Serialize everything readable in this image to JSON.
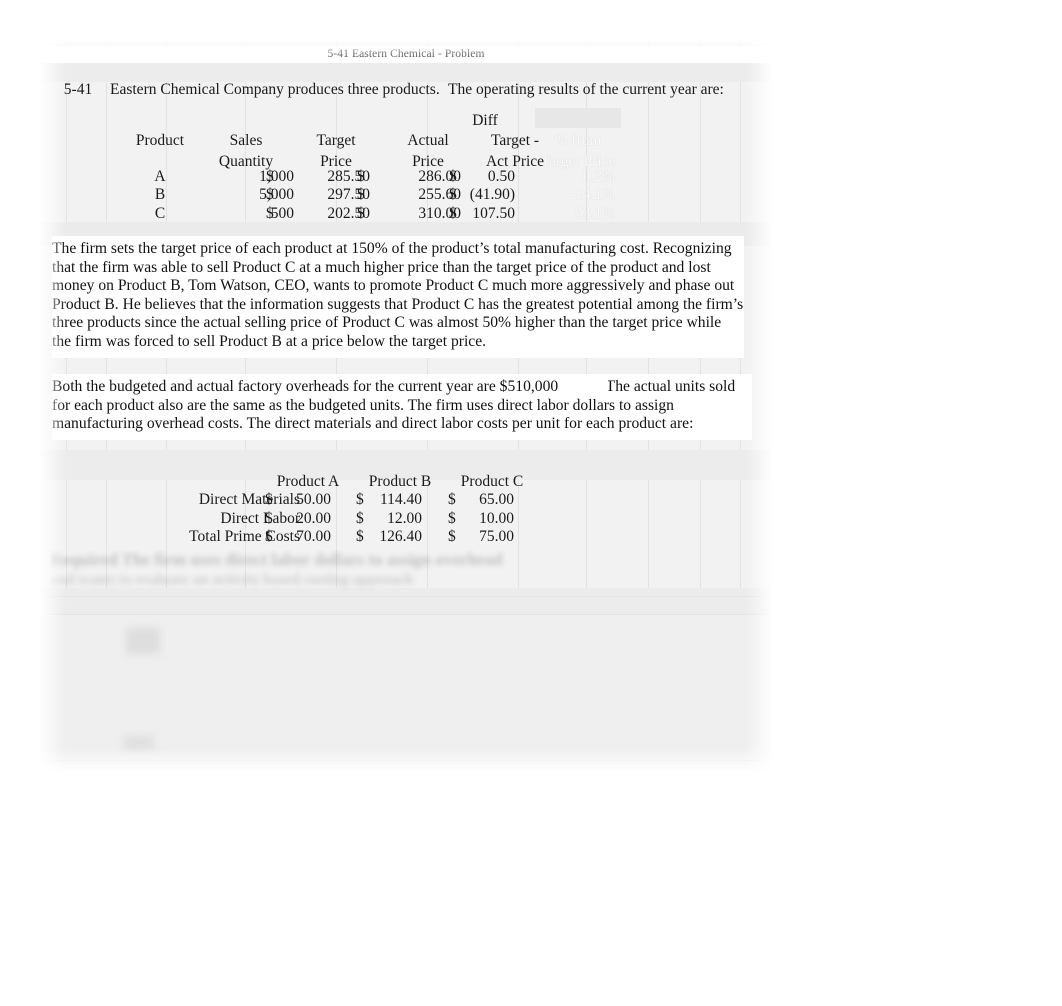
{
  "document": {
    "page_header": "5-41 Eastern Chemical - Problem",
    "problem_number": "5-41",
    "intro_left": "Eastern Chemical Company produces three products.",
    "intro_right": "The operating results of the current year are:"
  },
  "operating_results_table": {
    "headers": {
      "diff_label": "Diff",
      "row1": [
        "Product",
        "Sales",
        "Target",
        "Actual",
        "Target -",
        "% from"
      ],
      "row2": [
        "",
        "Quantity",
        "Price",
        "Price",
        "Act Price",
        "Target Price"
      ]
    },
    "rows": [
      {
        "product": "A",
        "sales_quantity": "1,000",
        "target_price_sym": "$",
        "target_price": "285.50",
        "actual_price_sym": "$",
        "actual_price": "286.00",
        "diff_sym": "$",
        "diff": "0.50",
        "pct_from_target": "0.2%"
      },
      {
        "product": "B",
        "sales_quantity": "5,000",
        "target_price_sym": "$",
        "target_price": "297.50",
        "actual_price_sym": "$",
        "actual_price": "255.60",
        "diff_sym": "$",
        "diff": "(41.90)",
        "pct_from_target": "-14.1%"
      },
      {
        "product": "C",
        "sales_quantity": "500",
        "target_price_sym": "$",
        "target_price": "202.50",
        "actual_price_sym": "$",
        "actual_price": "310.00",
        "diff_sym": "$",
        "diff": "107.50",
        "pct_from_target": "53.1%"
      }
    ]
  },
  "narrative": {
    "paragraph_1": "The firm sets the target price of each product at 150% of the product’s total manufacturing cost.  Recognizing that the firm was able to sell Product C at a much higher price than the target price of the product and lost money on Product B, Tom Watson, CEO, wants to promote Product C much more aggressively and phase out Product B.   He believes that the information suggests that Product C has the greatest potential among the firm’s three products since the actual selling price of Product C was almost 50% higher than the target price while the firm was forced to sell Product B at a price below the target price.",
    "paragraph_2_part_a": "Both the budgeted and actual factory overheads for the current year are $510,000",
    "paragraph_2_part_b": ".  The actual units sold for each product also are the same as the budgeted units.     The firm uses direct labor dollars  to assign manufacturing overhead costs.   The direct materials and direct labor costs per unit for each product are:"
  },
  "prime_cost_table": {
    "column_headers": [
      "",
      "Product A",
      "Product B",
      "Product C"
    ],
    "rows": [
      {
        "label": "Direct Materials",
        "a_sym": "$",
        "a": "50.00",
        "b_sym": "$",
        "b": "114.40",
        "c_sym": "$",
        "c": "65.00"
      },
      {
        "label": "Direct Labor",
        "a_sym": "$",
        "a": "20.00",
        "b_sym": "$",
        "b": "12.00",
        "c_sym": "$",
        "c": "10.00"
      },
      {
        "label": "Total Prime Costs",
        "a_sym": "$",
        "a": "70.00",
        "b_sym": "$",
        "b": "126.40",
        "c_sym": "$",
        "c": "75.00"
      }
    ]
  },
  "illegible_region": {
    "line_1": "Required  The firm uses direct labor dollars to assign overhead",
    "line_2": "and wants to evaluate an activity based costing approach"
  },
  "colors": {
    "sheet_background": "#f2f2f2",
    "text": "#1a1a1a",
    "gridline": "#e2e2e2",
    "ghost_text": "#fbfbfb"
  }
}
